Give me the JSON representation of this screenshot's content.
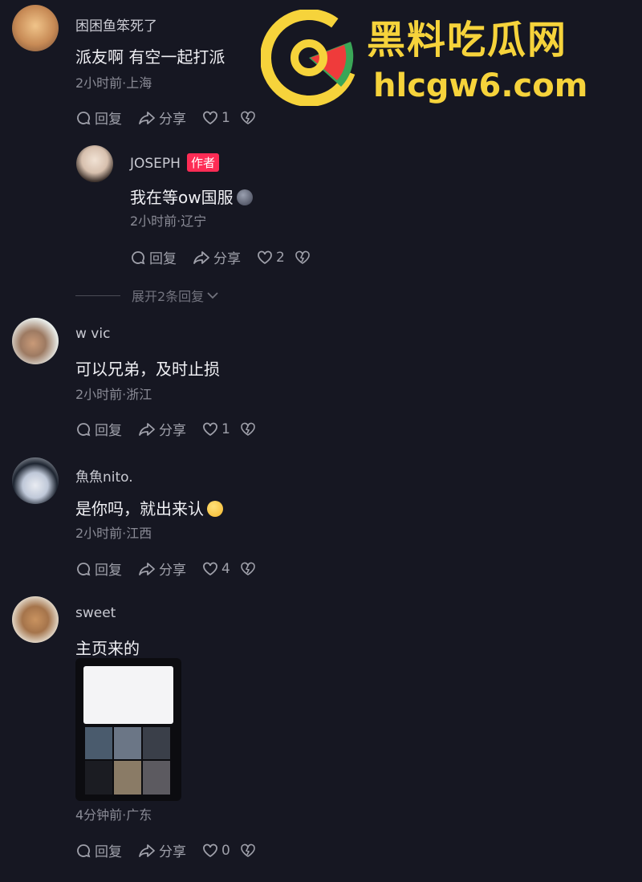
{
  "watermark": {
    "title": "黑料吃瓜网",
    "url": "hlcgw6.com",
    "color": "#f6d33b"
  },
  "comments": [
    {
      "username": "困困鱼笨死了",
      "text": "派友啊 有空一起打派",
      "meta": "2小时前·上海",
      "reply_label": "回复",
      "share_label": "分享",
      "likes": "1"
    },
    {
      "username": "JOSEPH",
      "badge": "作者",
      "text": "我在等ow国服",
      "meta": "2小时前·辽宁",
      "reply_label": "回复",
      "share_label": "分享",
      "likes": "2"
    },
    {
      "username": "w vic",
      "text": "可以兄弟，及时止损",
      "meta": "2小时前·浙江",
      "reply_label": "回复",
      "share_label": "分享",
      "likes": "1"
    },
    {
      "username": "魚魚nito.",
      "text": "是你吗，就出来认",
      "meta": "2小时前·江西",
      "reply_label": "回复",
      "share_label": "分享",
      "likes": "4"
    },
    {
      "username": "sweet",
      "text": "主页来的",
      "meta": "4分钟前·广东",
      "reply_label": "回复",
      "share_label": "分享",
      "likes": "0"
    }
  ],
  "expand_replies": "展开2条回复",
  "colors": {
    "background": "#161722",
    "author_badge": "#fe2c55",
    "meta_text": "#8a8b96"
  },
  "icons": [
    "reply-icon",
    "share-icon",
    "like-heart-icon",
    "dislike-icon",
    "chevron-down-icon"
  ]
}
